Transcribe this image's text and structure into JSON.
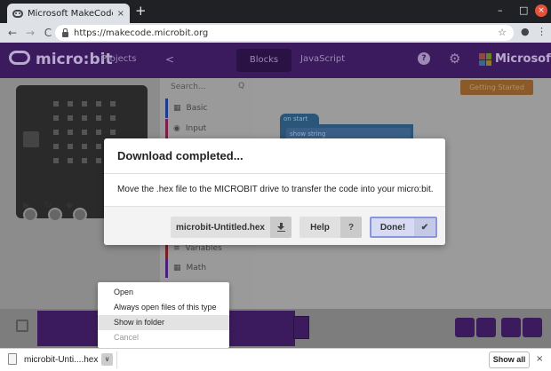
{
  "browser": {
    "tab_title": "Microsoft MakeCode for micro:bit",
    "tab_close": "×",
    "new_tab": "+",
    "minimize": "–",
    "maximize": "□",
    "close": "×",
    "url": "https://makecode.microbit.org",
    "back": "←",
    "forward": "→",
    "reload": "C",
    "star": "☆",
    "account": "●",
    "menu": "⋮"
  },
  "makecode": {
    "logo_text": "micro:bit",
    "projects": "Projects",
    "share": "<",
    "blocks_tab": "Blocks",
    "javascript_tab": "JavaScript",
    "help": "?",
    "settings": "⚙",
    "microsoft": "Microsoft",
    "search_placeholder": "Search...",
    "search_icon": "Q",
    "categories": [
      {
        "label": "Basic",
        "color": "#1e3a8a"
      },
      {
        "label": "Input",
        "color": "#7a1f4a"
      },
      {
        "label": "Variables",
        "color": "#7a1f2a"
      },
      {
        "label": "Math",
        "color": "#4a1f7a"
      }
    ],
    "getting_started": "Getting Started",
    "on_start": "on start",
    "show_string": "show string"
  },
  "modal": {
    "title": "Download completed...",
    "body": "Move the .hex file to the MICROBIT drive to transfer the code into your micro:bit.",
    "file_button": "microbit-Untitled.hex",
    "help_button": "Help",
    "help_icon": "?",
    "done_button": "Done!",
    "done_icon": "✔"
  },
  "context_menu": {
    "items": [
      {
        "label": "Open",
        "state": "normal"
      },
      {
        "label": "Always open files of this type",
        "state": "normal"
      },
      {
        "label": "Show in folder",
        "state": "highlighted"
      },
      {
        "label": "Cancel",
        "state": "disabled"
      }
    ]
  },
  "downloads_bar": {
    "file_name": "microbit-Unti....hex",
    "menu_toggle": "∨",
    "show_all": "Show all",
    "close": "×"
  }
}
